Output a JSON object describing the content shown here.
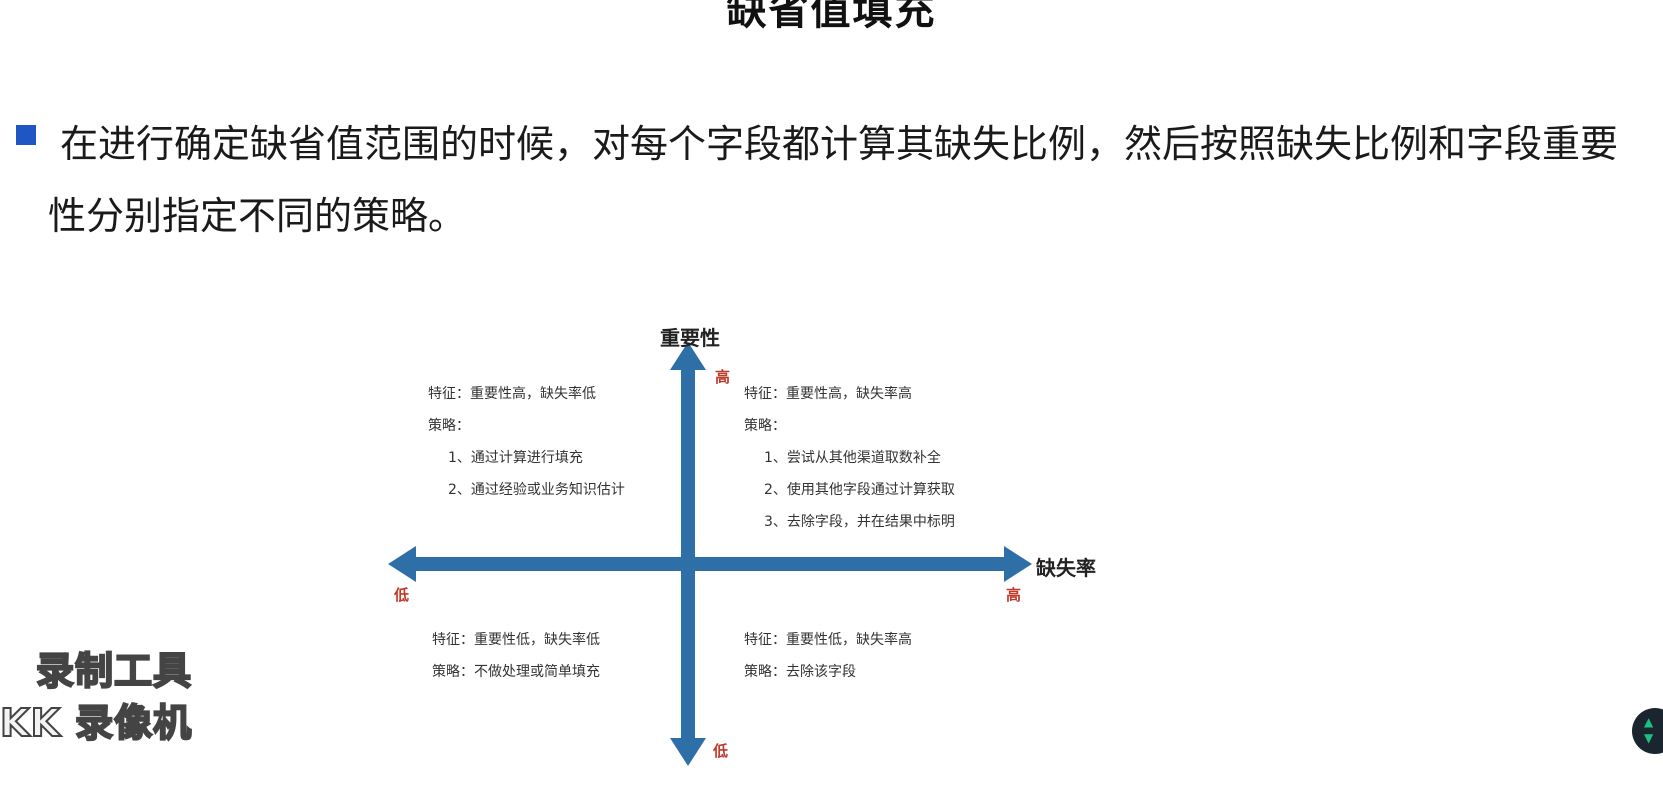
{
  "title": "缺省值填充",
  "bullet_text": "在进行确定缺省值范围的时候，对每个字段都计算其缺失比例，然后按照缺失比例和字段重要性分别指定不同的策略。",
  "diagram": {
    "y_axis_label": "重要性",
    "x_axis_label": "缺失率",
    "y_high": "高",
    "y_low": "低",
    "x_high": "高",
    "x_low": "低",
    "axis_color": "#2f6fa7",
    "quadrants": {
      "top_left": {
        "feature": "特征：重要性高，缺失率低",
        "strategy": "策略：",
        "items": [
          "1、通过计算进行填充",
          "2、通过经验或业务知识估计"
        ]
      },
      "top_right": {
        "feature": "特征：重要性高，缺失率高",
        "strategy": "策略：",
        "items": [
          "1、尝试从其他渠道取数补全",
          "2、使用其他字段通过计算获取",
          "3、去除字段，并在结果中标明"
        ]
      },
      "bottom_left": {
        "feature": "特征：重要性低，缺失率低",
        "strategy": "策略：不做处理或简单填充"
      },
      "bottom_right": {
        "feature": "特征：重要性低，缺失率高",
        "strategy": "策略：去除该字段"
      }
    }
  },
  "watermark": {
    "line1": "录制工具",
    "line2": "KK 录像机"
  },
  "widget": {
    "up": "▲",
    "down": "▼"
  }
}
